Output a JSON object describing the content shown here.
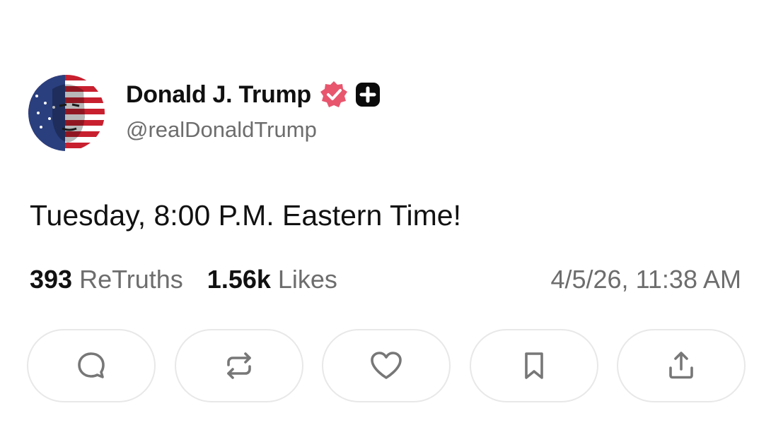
{
  "post": {
    "author": {
      "display_name": "Donald J. Trump",
      "handle": "@realDonaldTrump",
      "verified": true
    },
    "text": "Tuesday, 8:00 P.M. Eastern Time!",
    "stats": {
      "retruths_count": "393",
      "retruths_label": "ReTruths",
      "likes_count": "1.56k",
      "likes_label": "Likes"
    },
    "timestamp": "4/5/26, 11:38 AM"
  },
  "actions": [
    {
      "icon": "comment-icon"
    },
    {
      "icon": "retruth-icon"
    },
    {
      "icon": "heart-icon"
    },
    {
      "icon": "bookmark-icon"
    },
    {
      "icon": "share-icon"
    }
  ],
  "colors": {
    "verified_badge": "#e8566e",
    "muted_text": "#6d6d6d",
    "button_border": "#e8e8e8",
    "icon_stroke": "#777777"
  }
}
